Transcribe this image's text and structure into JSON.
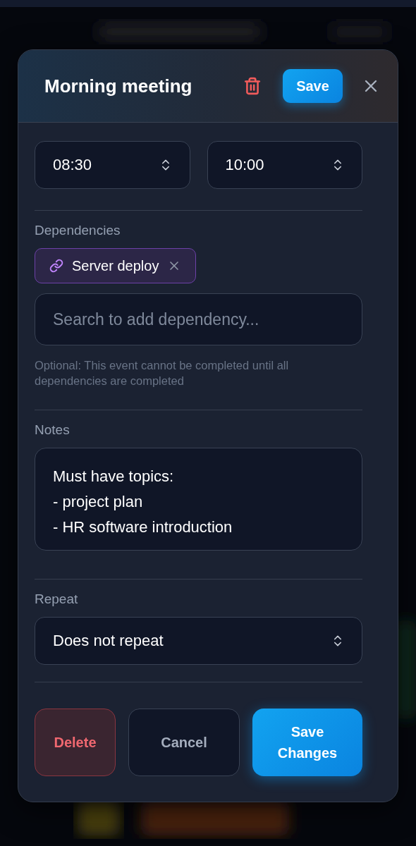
{
  "dialog": {
    "title": "Morning meeting",
    "header_save": "Save"
  },
  "times": [
    {
      "value": "08:30"
    },
    {
      "value": "10:00"
    }
  ],
  "dependencies": {
    "label": "Dependencies",
    "chips": [
      {
        "label": "Server deploy"
      }
    ],
    "search": {
      "placeholder": "Search to add dependency..."
    },
    "hint": "Optional: This event cannot be completed until all dependencies are completed"
  },
  "notes": {
    "label": "Notes",
    "value": "Must have topics:\n- project plan\n- HR software introduction"
  },
  "repeat": {
    "label": "Repeat",
    "value": "Does not repeat"
  },
  "actions": [
    {
      "kind": "danger",
      "label": "Delete"
    },
    {
      "kind": "neutral",
      "label": "Cancel"
    },
    {
      "kind": "primary",
      "label": "Save Changes"
    }
  ]
}
